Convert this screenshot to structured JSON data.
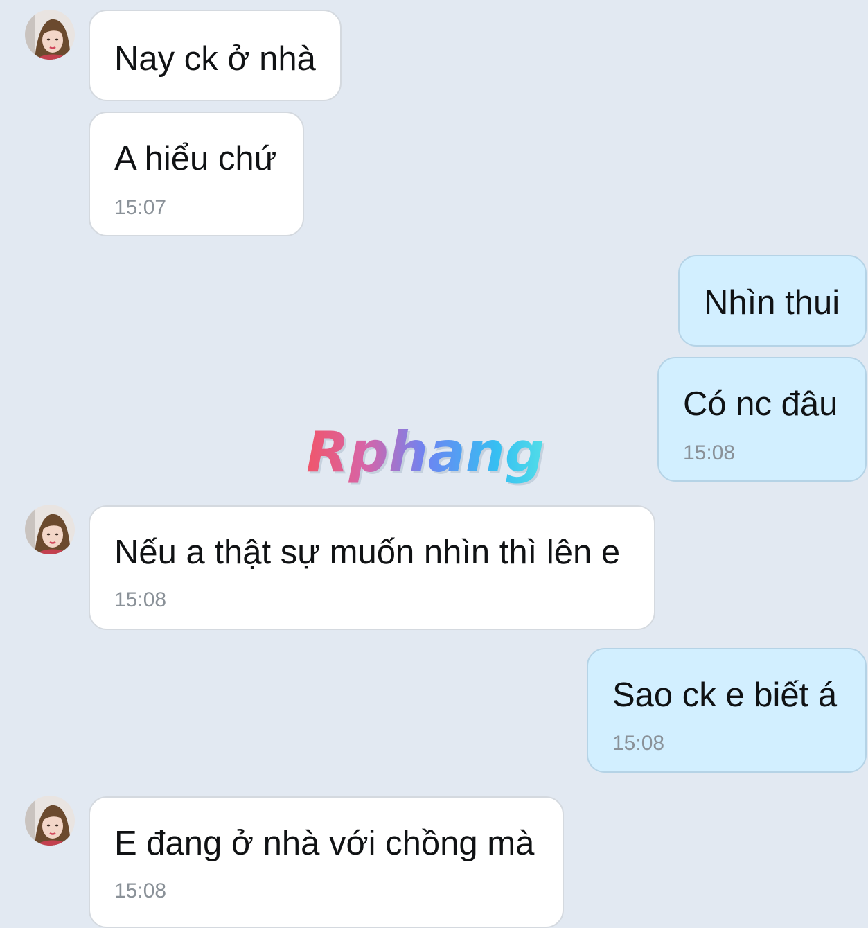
{
  "watermark": {
    "text": "Rphang"
  },
  "messages": [
    {
      "sender": "contact",
      "text": "Nay ck ở nhà",
      "time": ""
    },
    {
      "sender": "contact",
      "text": "A hiểu chứ",
      "time": "15:07"
    },
    {
      "sender": "me",
      "text": "Nhìn thui",
      "time": ""
    },
    {
      "sender": "me",
      "text": "Có nc đâu",
      "time": "15:08"
    },
    {
      "sender": "contact",
      "text": "Nếu a thật sự muốn nhìn thì lên e",
      "time": "15:08"
    },
    {
      "sender": "me",
      "text": "Sao ck e biết á",
      "time": "15:08"
    },
    {
      "sender": "contact",
      "text": "E đang ở nhà với chồng mà",
      "time": "15:08"
    }
  ],
  "colors": {
    "background": "#e2e9f2",
    "incoming_bubble": "#ffffff",
    "outgoing_bubble": "#d2efff",
    "timestamp": "#8a9198"
  }
}
